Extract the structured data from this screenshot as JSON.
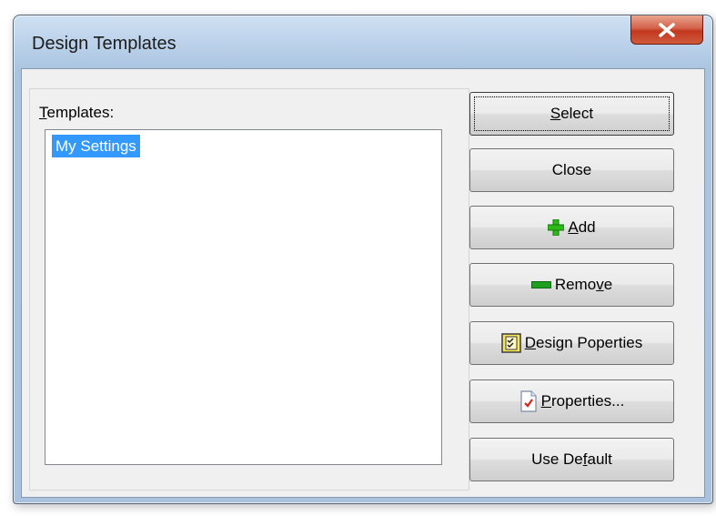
{
  "window": {
    "title": "Design Templates"
  },
  "templates": {
    "label_key": "T",
    "label_rest": "emplates:",
    "items": [
      "My Settings"
    ],
    "selected_index": 0
  },
  "buttons": {
    "select": {
      "key": "S",
      "rest": "elect"
    },
    "close": {
      "label": "Close"
    },
    "add": {
      "key": "A",
      "rest": "dd",
      "icon": "plus-icon"
    },
    "remove": {
      "pre": "Remo",
      "key": "v",
      "post": "e",
      "icon": "minus-icon"
    },
    "design_properties": {
      "key": "D",
      "rest": "esign Poperties",
      "icon": "checklist-icon"
    },
    "properties": {
      "key": "P",
      "rest": "roperties...",
      "icon": "document-check-icon"
    },
    "use_default": {
      "pre": "Use De",
      "key": "f",
      "post": "ault"
    }
  },
  "colors": {
    "selection": "#3399ff",
    "close_button": "#c1381f",
    "plus_icon": "#2fb81a",
    "minus_icon": "#1f9e1f"
  }
}
